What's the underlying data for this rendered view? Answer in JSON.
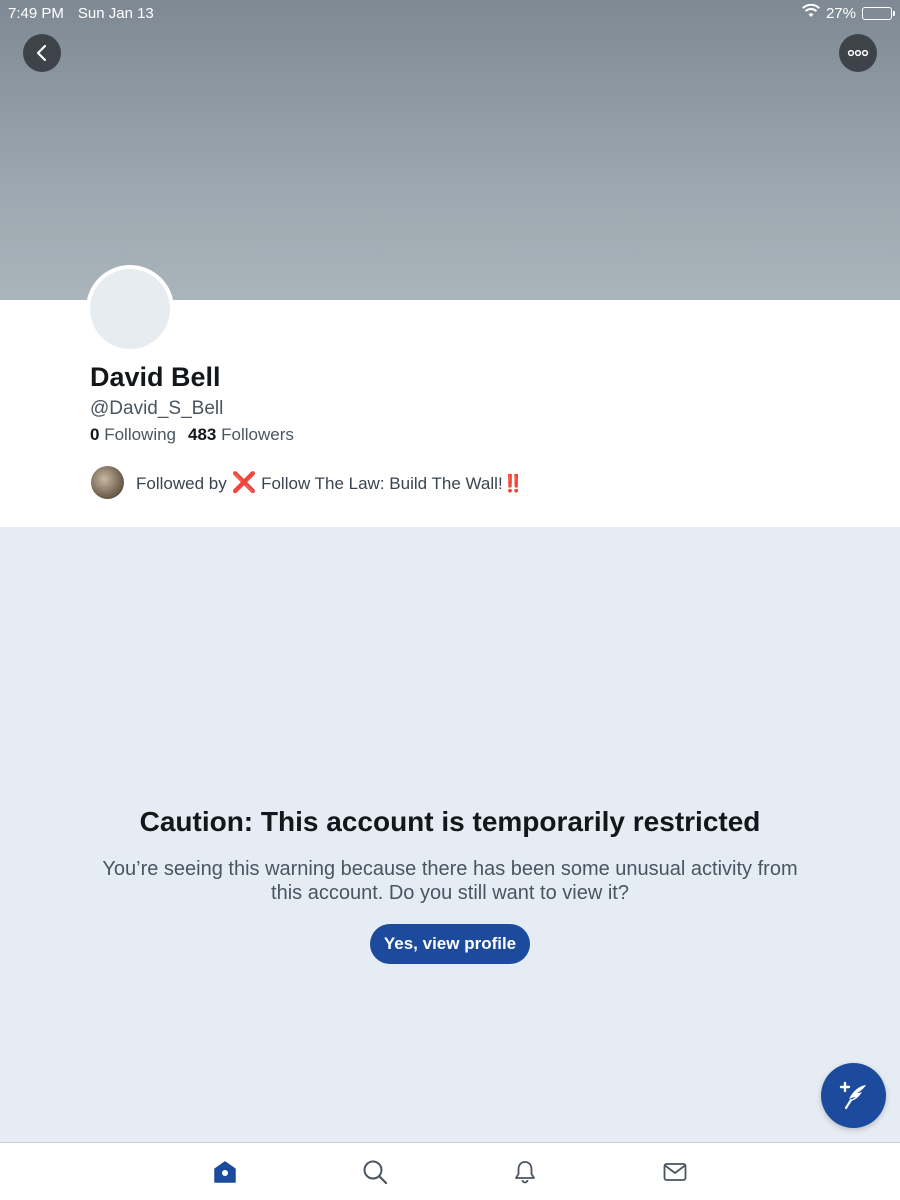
{
  "status_bar": {
    "time": "7:49 PM",
    "date": "Sun Jan 13",
    "battery": "27%",
    "battery_level": 0.27
  },
  "nav": {
    "back_icon": "chevron-left-icon",
    "more_icon": "ellipsis-icon"
  },
  "profile": {
    "name": "David Bell",
    "handle": "@David_S_Bell",
    "following_count": "0",
    "following_label": "Following",
    "followers_count": "483",
    "followers_label": "Followers",
    "followed_by_prefix": "Followed by",
    "followed_by_x": "❌",
    "followed_by_name": "Follow The Law: Build The Wall!",
    "followed_by_suffix": "‼️"
  },
  "warning": {
    "title": "Caution: This account is temporarily restricted",
    "body": "You’re seeing this warning because there has been some unusual activity from this account. Do you still want to view it?",
    "button": "Yes, view profile"
  },
  "tabs": [
    {
      "icon": "home-icon",
      "active": true
    },
    {
      "icon": "search-icon",
      "active": false
    },
    {
      "icon": "bell-icon",
      "active": false
    },
    {
      "icon": "mail-icon",
      "active": false
    }
  ],
  "colors": {
    "accent": "#1c4a9c",
    "banner": "#8e99a2",
    "background": "#e6ecf3"
  }
}
